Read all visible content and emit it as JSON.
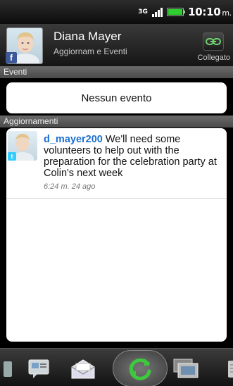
{
  "status_bar": {
    "network": "3G",
    "time": "10:10",
    "time_suffix": "m."
  },
  "header": {
    "contact_name": "Diana Mayer",
    "subtitle": "Aggiornam e Eventi",
    "link_status": "Collegato",
    "social_badge": "f"
  },
  "events": {
    "section_label": "Eventi",
    "empty_text": "Nessun evento"
  },
  "updates": {
    "section_label": "Aggiornamenti",
    "items": [
      {
        "username": "d_mayer200",
        "message": " We'll need some volunteers to help out with the preparation for the celebration party at Colin's next week",
        "timestamp": "6:24 m. 24 ago",
        "source_badge": "t"
      }
    ]
  },
  "toolbar": {
    "items": [
      "messages-icon",
      "email-icon",
      "refresh-icon",
      "gallery-icon",
      "more-icon"
    ],
    "active": "refresh-icon"
  },
  "colors": {
    "username": "#1a6fd0",
    "facebook": "#3b5998",
    "twitter": "#33ccff",
    "battery": "#2fcf2f",
    "refresh": "#3ec83e"
  }
}
